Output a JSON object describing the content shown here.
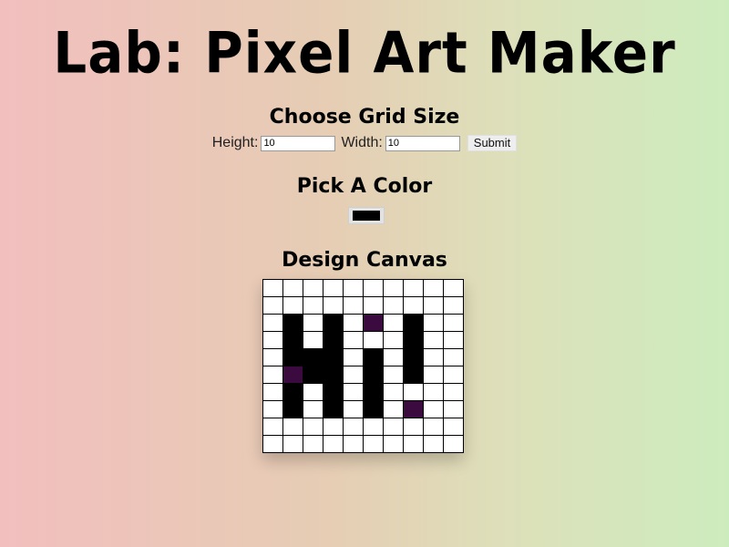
{
  "title": "Lab: Pixel Art Maker",
  "grid_size": {
    "heading": "Choose Grid Size",
    "height_label": "Height:",
    "height_value": "10",
    "width_label": "Width:",
    "width_value": "10",
    "submit_label": "Submit"
  },
  "color": {
    "heading": "Pick A Color",
    "value": "#000000"
  },
  "canvas": {
    "heading": "Design Canvas",
    "rows": 10,
    "cols": 10,
    "colors": {
      ".": "#ffffff",
      "K": "#000000",
      "P": "#3b0a3f"
    },
    "pixels": [
      "..........",
      "..........",
      ".K.K.P.K..",
      ".K.K...K..",
      ".KKK.K.K..",
      ".PKK.K.K..",
      ".K.K.K....",
      ".K.K.K.P..",
      "..........",
      ".........."
    ]
  }
}
